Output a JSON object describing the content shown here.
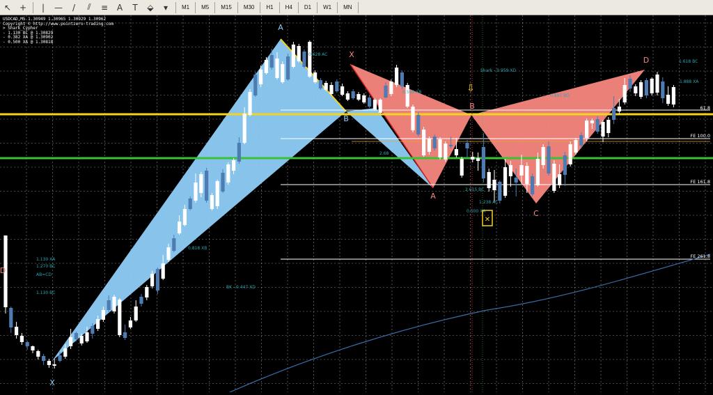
{
  "toolbar": {
    "tools": [
      {
        "name": "cursor-icon",
        "glyph": "↖"
      },
      {
        "name": "crosshair-icon",
        "glyph": "+"
      },
      {
        "sep": true
      },
      {
        "name": "vertical-line-icon",
        "glyph": "|"
      },
      {
        "name": "horizontal-line-icon",
        "glyph": "—"
      },
      {
        "name": "trendline-icon",
        "glyph": "/"
      },
      {
        "name": "channel-icon",
        "glyph": "⫽"
      },
      {
        "name": "fibonacci-icon",
        "glyph": "≡"
      },
      {
        "name": "text-icon",
        "glyph": "A"
      },
      {
        "name": "text-label-icon",
        "glyph": "T"
      },
      {
        "name": "shapes-icon",
        "glyph": "⬙"
      },
      {
        "name": "arrow-dropdown-icon",
        "glyph": "▾"
      },
      {
        "sep": true
      }
    ],
    "timeframes": [
      "M1",
      "M5",
      "M15",
      "M30",
      "H1",
      "H4",
      "D1",
      "W1",
      "MN"
    ]
  },
  "info": {
    "line1": "USDCAD,M5  1.30949 1.30965 1.30929 1.30962",
    "line2": "Copyright © http://www.pointzero-trading.com",
    "line3": "> Shark_Cypher",
    "line4": "- 1.130 BC @ 1.30829",
    "line5": "- 0.382 XA @ 1.30902",
    "line6": "- 0.500 XA @ 1.30818"
  },
  "colors": {
    "blue_fill": "#8ecdf8",
    "red_fill": "#f88780",
    "yellow": "#f5d320",
    "green": "#39c234",
    "bull_candle": "#ffffff",
    "bear_candle": "#4d7bb2",
    "grid": "#ffffff",
    "red_line": "#d42020",
    "teal_text": "#2aa6b2",
    "blue_ma": "#3a6da6",
    "orange": "#e8a43c"
  },
  "labels": {
    "p_A1": "A",
    "p_B1": "B",
    "p_X1": "X",
    "p_X2": "X",
    "p_A2": "A",
    "p_B2": "B",
    "p_C2": "C",
    "p_D2": "D",
    "p_D_left": "D"
  },
  "ratios": {
    "r1": "0.628 AC",
    "r2": "Shark - 0.959 XD",
    "r3": "0.599 XB",
    "r4": "0.897 BD",
    "r5": "0.818 XB",
    "r6": "BK - 0.447 XD",
    "r7": "2.68",
    "r8": "2.615 BC",
    "r9": "1.238 AC",
    "r10": "0.500 XA",
    "r11": "1.618 BC",
    "r12": "1.888 XA",
    "r13": "1.130 XA",
    "r14": "1.270 BC",
    "r15": "AB=CD",
    "r16": "1.130 BC"
  },
  "fe": {
    "fe1": "61.8",
    "fe2": "FE 100.0",
    "fe3": "FE 161.8",
    "fe4": "FE 261.8"
  },
  "chart_data": {
    "type": "candlestick",
    "symbol": "USDCAD",
    "timeframe": "M5",
    "candles": [
      [
        338,
        342,
        441,
        450
      ],
      [
        442,
        440,
        470,
        478
      ],
      [
        469,
        462,
        481,
        486
      ],
      [
        482,
        478,
        491,
        495
      ],
      [
        491,
        489,
        497,
        502
      ],
      [
        497,
        496,
        503,
        507
      ],
      [
        504,
        502,
        512,
        516
      ],
      [
        511,
        508,
        518,
        524
      ],
      [
        518,
        515,
        524,
        528
      ],
      [
        523,
        515,
        524,
        529
      ],
      [
        510,
        505,
        518,
        520
      ],
      [
        500,
        494,
        512,
        515
      ],
      [
        484,
        472,
        497,
        501
      ],
      [
        478,
        476,
        487,
        490
      ],
      [
        482,
        479,
        493,
        496
      ],
      [
        477,
        469,
        490,
        492
      ],
      [
        468,
        464,
        479,
        486
      ],
      [
        458,
        453,
        472,
        475
      ],
      [
        445,
        440,
        459,
        462
      ],
      [
        431,
        424,
        445,
        448
      ],
      [
        426,
        423,
        447,
        450
      ],
      [
        430,
        428,
        481,
        484
      ],
      [
        477,
        466,
        485,
        488
      ],
      [
        460,
        455,
        470,
        472
      ],
      [
        440,
        431,
        460,
        462
      ],
      [
        426,
        422,
        436,
        440
      ],
      [
        412,
        409,
        427,
        431
      ],
      [
        393,
        389,
        411,
        414
      ],
      [
        386,
        384,
        417,
        422
      ],
      [
        378,
        366,
        400,
        402
      ],
      [
        355,
        350,
        373,
        376
      ],
      [
        342,
        337,
        360,
        362
      ],
      [
        318,
        309,
        335,
        337
      ],
      [
        300,
        294,
        323,
        325
      ],
      [
        285,
        282,
        300,
        302
      ],
      [
        262,
        249,
        288,
        291
      ],
      [
        250,
        247,
        277,
        283
      ],
      [
        245,
        241,
        288,
        291
      ],
      [
        280,
        277,
        300,
        302
      ],
      [
        260,
        258,
        296,
        300
      ],
      [
        248,
        243,
        275,
        277
      ],
      [
        236,
        233,
        262,
        265
      ],
      [
        230,
        227,
        245,
        250
      ],
      [
        205,
        197,
        232,
        235
      ],
      [
        163,
        154,
        205,
        207
      ],
      [
        132,
        128,
        165,
        167
      ],
      [
        107,
        103,
        137,
        139
      ],
      [
        100,
        94,
        121,
        125
      ],
      [
        86,
        82,
        105,
        107
      ],
      [
        79,
        70,
        97,
        100
      ],
      [
        84,
        75,
        112,
        114
      ],
      [
        92,
        88,
        118,
        120
      ],
      [
        81,
        77,
        114,
        116
      ],
      [
        64,
        60,
        96,
        98
      ],
      [
        66,
        63,
        88,
        90
      ],
      [
        74,
        71,
        96,
        98
      ],
      [
        60,
        58,
        110,
        112
      ],
      [
        104,
        101,
        118,
        120
      ],
      [
        115,
        112,
        127,
        129
      ],
      [
        119,
        116,
        129,
        131
      ],
      [
        122,
        118,
        135,
        137
      ],
      [
        117,
        114,
        131,
        133
      ],
      [
        124,
        120,
        136,
        138
      ],
      [
        134,
        131,
        143,
        145
      ],
      [
        131,
        128,
        141,
        143
      ],
      [
        135,
        132,
        143,
        145
      ],
      [
        137,
        134,
        147,
        149
      ],
      [
        140,
        137,
        153,
        155
      ],
      [
        143,
        141,
        157,
        159
      ],
      [
        143,
        141,
        162,
        164
      ],
      [
        123,
        118,
        140,
        141
      ],
      [
        117,
        114,
        135,
        138
      ],
      [
        97,
        93,
        122,
        125
      ],
      [
        104,
        101,
        124,
        128
      ],
      [
        122,
        119,
        153,
        155
      ],
      [
        153,
        150,
        187,
        190
      ],
      [
        165,
        161,
        193,
        196
      ],
      [
        186,
        182,
        223,
        225
      ],
      [
        199,
        196,
        218,
        222
      ],
      [
        196,
        193,
        213,
        216
      ],
      [
        200,
        197,
        226,
        229
      ],
      [
        206,
        203,
        229,
        232
      ],
      [
        208,
        196,
        210,
        213
      ],
      [
        214,
        198,
        223,
        226
      ],
      [
        228,
        225,
        252,
        255
      ],
      [
        205,
        201,
        213,
        227
      ],
      [
        225,
        218,
        229,
        233
      ],
      [
        227,
        219,
        231,
        245
      ],
      [
        211,
        191,
        256,
        262
      ],
      [
        247,
        242,
        270,
        275
      ],
      [
        258,
        244,
        273,
        291
      ],
      [
        261,
        259,
        288,
        292
      ],
      [
        240,
        228,
        281,
        284
      ],
      [
        237,
        231,
        253,
        268
      ],
      [
        255,
        242,
        262,
        282
      ],
      [
        237,
        222,
        252,
        264
      ],
      [
        238,
        233,
        264,
        277
      ],
      [
        253,
        249,
        279,
        282
      ],
      [
        228,
        219,
        266,
        268
      ],
      [
        211,
        207,
        237,
        242
      ],
      [
        210,
        203,
        249,
        252
      ],
      [
        235,
        230,
        274,
        277
      ],
      [
        250,
        236,
        266,
        270
      ],
      [
        223,
        218,
        251,
        267
      ],
      [
        207,
        203,
        236,
        239
      ],
      [
        201,
        198,
        219,
        222
      ],
      [
        194,
        190,
        209,
        213
      ],
      [
        173,
        170,
        198,
        203
      ],
      [
        173,
        170,
        177,
        185
      ],
      [
        171,
        167,
        189,
        192
      ],
      [
        175,
        172,
        196,
        204
      ],
      [
        172,
        168,
        191,
        197
      ],
      [
        155,
        138,
        172,
        178
      ],
      [
        153,
        142,
        160,
        164
      ],
      [
        122,
        112,
        147,
        150
      ],
      [
        113,
        108,
        127,
        132
      ],
      [
        124,
        121,
        134,
        138
      ],
      [
        118,
        115,
        139,
        142
      ],
      [
        115,
        112,
        137,
        141
      ],
      [
        113,
        111,
        134,
        137
      ],
      [
        107,
        103,
        133,
        137
      ],
      [
        117,
        111,
        141,
        148
      ],
      [
        136,
        124,
        149,
        152
      ],
      [
        125,
        122,
        150,
        154
      ]
    ],
    "candle_format": "each candle: [top_of_range, high, low, bottom_of_range] vertical extents are encoded as price-axis readings"
  }
}
